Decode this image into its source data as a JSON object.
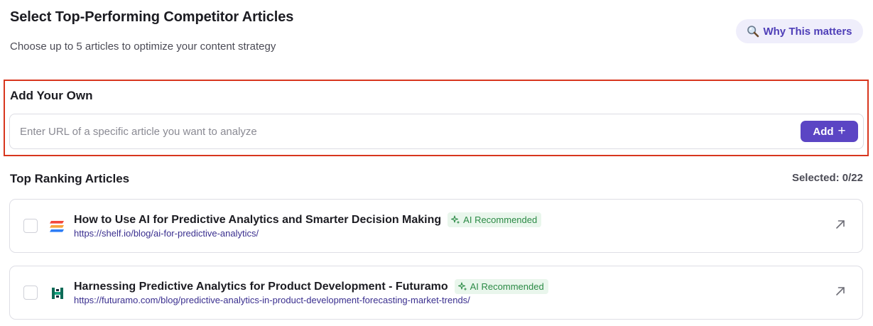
{
  "header": {
    "title": "Select Top-Performing Competitor Articles",
    "subtitle": "Choose up to 5 articles to optimize your content strategy",
    "why_button_label": "Why This matters",
    "why_button_icon": "magnifier-icon"
  },
  "add_own": {
    "title": "Add Your Own",
    "input_value": "",
    "input_placeholder": "Enter URL of a specific article you want to analyze",
    "add_button_label": "Add",
    "add_button_icon": "+"
  },
  "ranking": {
    "title": "Top Ranking Articles",
    "selected_label": "Selected: 0/22",
    "articles": [
      {
        "title": "How to Use AI for Predictive Analytics and Smarter Decision Making",
        "badge": "AI Recommended",
        "url": "https://shelf.io/blog/ai-for-predictive-analytics/",
        "favicon": "shelf-logo-icon",
        "checked": false
      },
      {
        "title": "Harnessing Predictive Analytics for Product Development - Futuramo",
        "badge": "AI Recommended",
        "url": "https://futuramo.com/blog/predictive-analytics-in-product-development-forecasting-market-trends/",
        "favicon": "futuramo-logo-icon",
        "checked": false
      }
    ]
  },
  "colors": {
    "accent": "#5b45c4",
    "highlight_border": "#d8361e",
    "badge_bg": "#e9f6ec",
    "badge_text": "#2b8a45",
    "link": "#3a2f8f"
  }
}
